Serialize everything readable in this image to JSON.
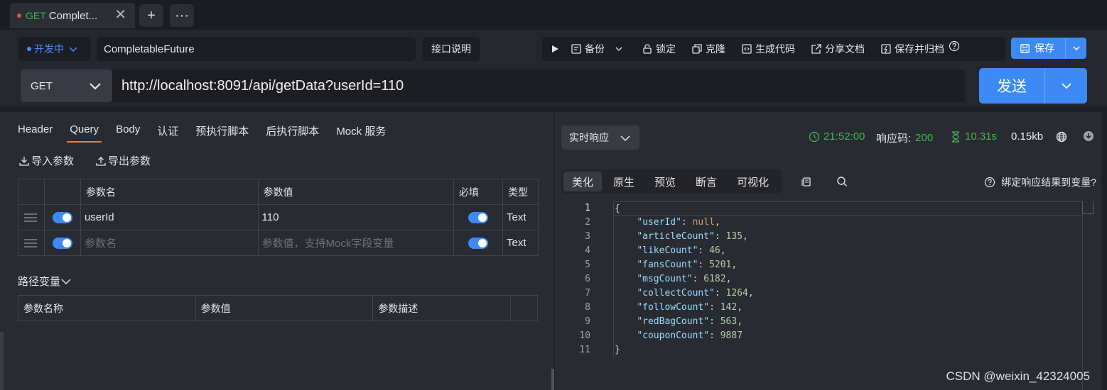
{
  "tab": {
    "method": "GET",
    "title": "Complet...",
    "close": "✕",
    "add": "+",
    "more": "···"
  },
  "toolbar": {
    "env_label": "开发中",
    "name_value": "CompletableFuture",
    "doc_label": "接口说明",
    "actions": {
      "backup": "备份",
      "lock": "锁定",
      "clone": "克隆",
      "gen_code": "生成代码",
      "share": "分享文档",
      "save_archive": "保存并归档"
    },
    "save_label": "保存"
  },
  "request": {
    "method": "GET",
    "url": "http://localhost:8091/api/getData?userId=110",
    "send_label": "发送"
  },
  "req_tabs": [
    "Header",
    "Query",
    "Body",
    "认证",
    "预执行脚本",
    "后执行脚本",
    "Mock 服务"
  ],
  "active_req_tab": "Query",
  "io": {
    "import": "导入参数",
    "export": "导出参数"
  },
  "params_table": {
    "headers": [
      "参数名",
      "参数值",
      "必填",
      "类型"
    ],
    "rows": [
      {
        "name": "userId",
        "value": "110",
        "type": "Text"
      },
      {
        "name": "",
        "value": "",
        "type": "Text"
      }
    ],
    "placeholder_name": "参数名",
    "placeholder_value": "参数值，支持Mock字段变量"
  },
  "path_vars": {
    "title": "路径变量",
    "headers": [
      "参数名称",
      "参数值",
      "参数描述"
    ]
  },
  "response": {
    "mode": "实时响应",
    "time": "21:52:00",
    "code_label": "响应码:",
    "code": "200",
    "duration": "10.31s",
    "size": "0.15kb",
    "view_tabs": [
      "美化",
      "原生",
      "预览",
      "断言",
      "可视化"
    ],
    "active_view": "美化",
    "bind_hint": "绑定响应结果到变量?",
    "line_numbers": [
      "1",
      "2",
      "3",
      "4",
      "5",
      "6",
      "7",
      "8",
      "9",
      "10",
      "11"
    ],
    "body": {
      "userId": "null",
      "articleCount": "135",
      "likeCount": "46",
      "fansCount": "5201",
      "msgCount": "6182",
      "collectCount": "1264",
      "followCount": "142",
      "redBagCount": "563",
      "couponCount": "9887"
    }
  },
  "watermark": "CSDN @weixin_42324005",
  "colors": {
    "accent": "#3d8af7",
    "success": "#3fb950",
    "active_tab_underline": "#e8803a"
  }
}
